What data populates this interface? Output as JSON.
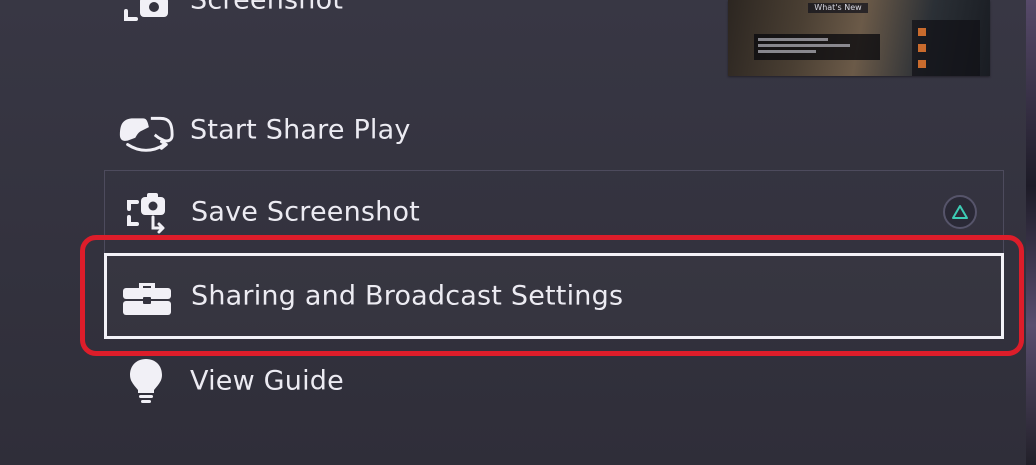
{
  "menu": {
    "items": [
      {
        "label": "Screenshot",
        "icon": "screenshot-icon"
      },
      {
        "label": "Start Share Play",
        "icon": "share-play-icon"
      },
      {
        "label": "Save Screenshot",
        "icon": "save-screenshot-icon",
        "shortcut_icon": "triangle-button-icon"
      },
      {
        "label": "Sharing and Broadcast Settings",
        "icon": "toolbox-icon",
        "selected": true
      },
      {
        "label": "View Guide",
        "icon": "lightbulb-icon"
      }
    ]
  },
  "preview": {
    "title": "What's New"
  },
  "annotation": {
    "highlight_color": "#dd1d2a"
  },
  "colors": {
    "background": "#34333f",
    "text": "#ecebf2",
    "selected_border": "#f3f2f8",
    "triangle_accent": "#3ccbb4"
  }
}
